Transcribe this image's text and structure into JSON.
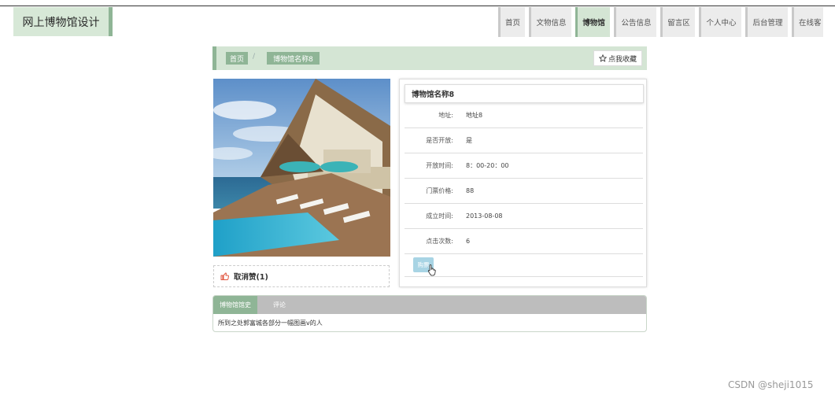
{
  "site": {
    "title": "网上博物馆设计"
  },
  "nav": [
    {
      "label": "首页",
      "active": false
    },
    {
      "label": "文物信息",
      "active": false
    },
    {
      "label": "博物馆",
      "active": true
    },
    {
      "label": "公告信息",
      "active": false
    },
    {
      "label": "留言区",
      "active": false
    },
    {
      "label": "个人中心",
      "active": false
    },
    {
      "label": "后台管理",
      "active": false
    },
    {
      "label": "在线客",
      "active": false
    }
  ],
  "breadcrumb": {
    "home": "首页",
    "separator": "/",
    "current": "博物馆名称8",
    "favorite_label": "点我收藏"
  },
  "detail": {
    "name": "博物馆名称8",
    "fields": [
      {
        "label": "地址:",
        "value": "地址8"
      },
      {
        "label": "是否开放:",
        "value": "是"
      },
      {
        "label": "开放时间:",
        "value": "8：00-20：00"
      },
      {
        "label": "门票价格:",
        "value": "88"
      },
      {
        "label": "成立时间:",
        "value": "2013-08-08"
      },
      {
        "label": "点击次数:",
        "value": "6"
      }
    ],
    "buy_label": "购票"
  },
  "like": {
    "label": "取消赞(1)"
  },
  "tabs": {
    "items": [
      {
        "label": "博物馆馆史",
        "active": true
      },
      {
        "label": "评论",
        "active": false
      }
    ],
    "content": "所到之处郭富城各部分一幅图画v的人"
  },
  "watermark": "CSDN @sheji1015",
  "colors": {
    "accent": "#8fb596",
    "accent_light": "#d4e5d4",
    "buy_button": "#a8d4e4",
    "like_icon": "#e0533c"
  }
}
